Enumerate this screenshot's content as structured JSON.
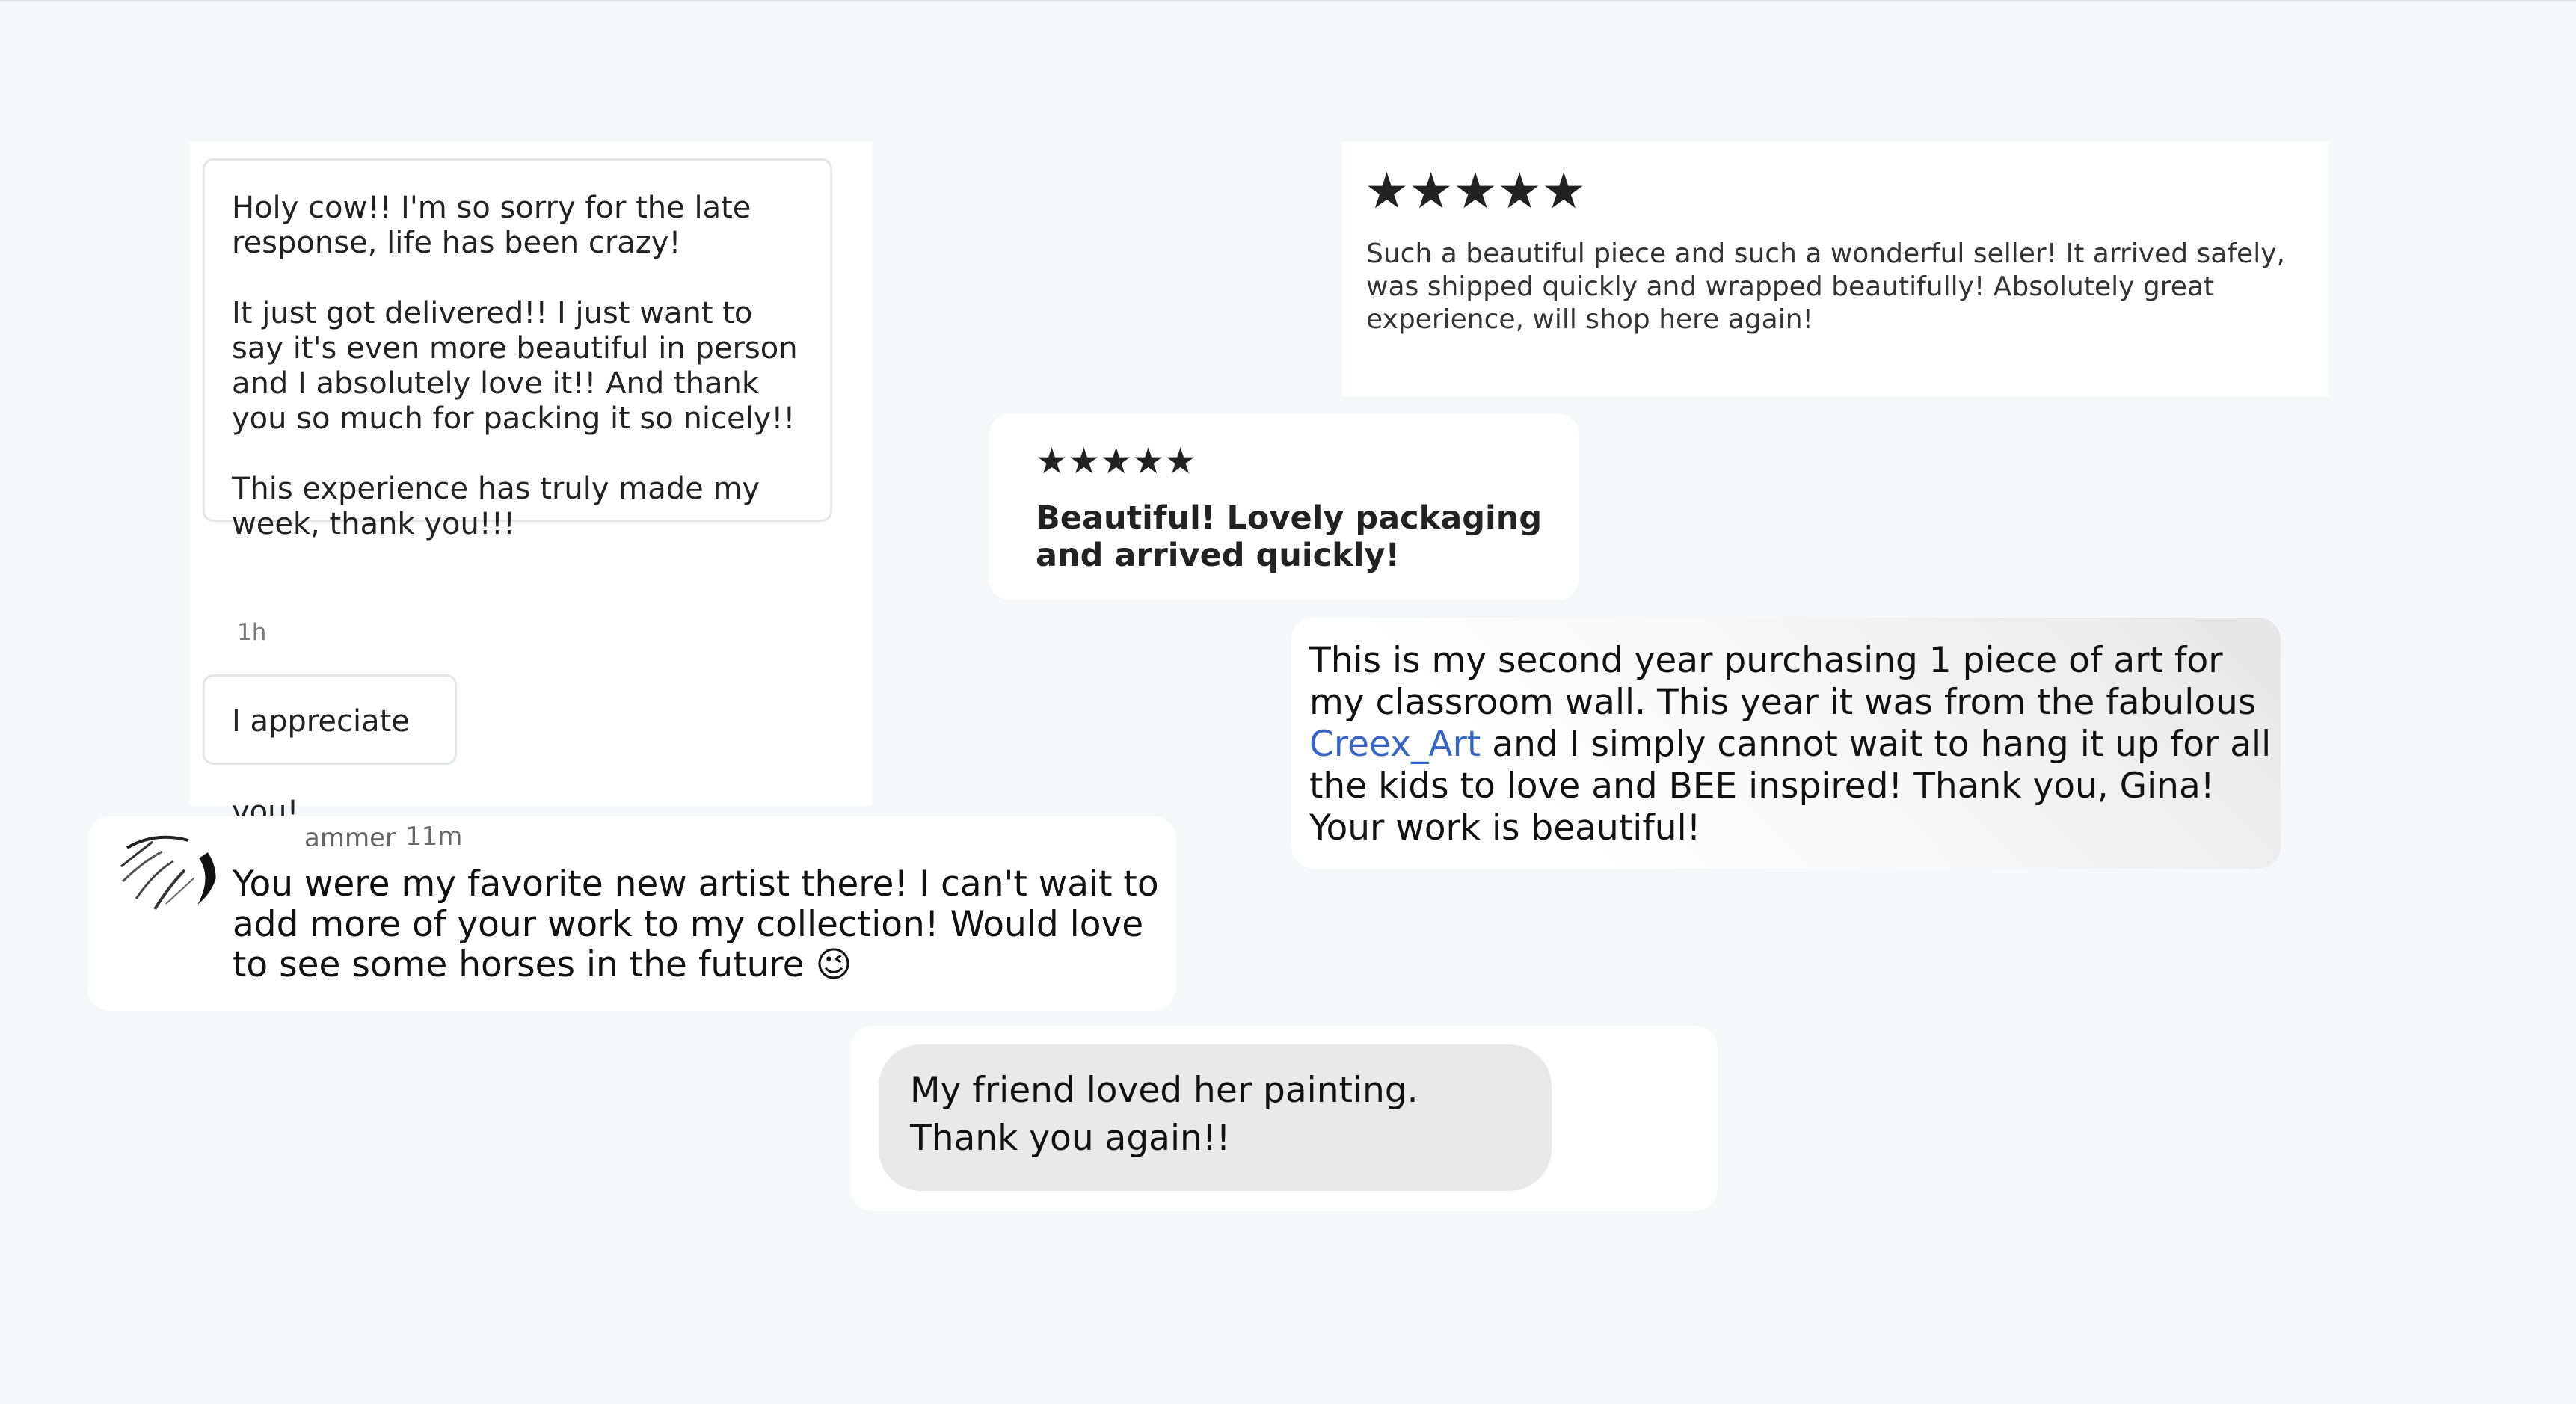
{
  "conversation": {
    "message_long": {
      "p1": "Holy cow!! I'm so sorry for the late response, life has been crazy!",
      "p2": "It just got delivered!! I just want to say it's even more beautiful in person and I absolutely love it!! And thank you so much for packing it so nicely!!",
      "p3": "This experience has truly made my week, thank you!!!"
    },
    "timestamp": "1h",
    "reply": "I appreciate you!"
  },
  "review_five_star": {
    "rating": 5,
    "stars": "★★★★★",
    "text": "Such a beautiful piece and such a wonderful seller! It arrived safely, was shipped quickly and wrapped beautifully! Absolutely great experience, will shop here again!"
  },
  "review_short": {
    "rating": 5,
    "stars": "★★★★★",
    "text": "Beautiful!  Lovely packaging and arrived quickly!"
  },
  "classroom_message": {
    "text_before": "This is my second year purchasing 1 piece of art for my classroom wall. This year it was from the fabulous ",
    "link": "Creex_Art",
    "text_after": " and I simply cannot wait to hang it up for all the kids to love and BEE inspired! Thank you, Gina! Your work is beautiful!",
    "link_color": "#3665c8"
  },
  "favorite_comment": {
    "username_obscured": "ammer",
    "timestamp": "11m",
    "text": "You were my favorite new artist there! I can't wait to add more of your work to my collection! Would love to see some horses in the future 😉"
  },
  "friend_message": {
    "text": "My friend loved her painting. Thank you again!!"
  }
}
